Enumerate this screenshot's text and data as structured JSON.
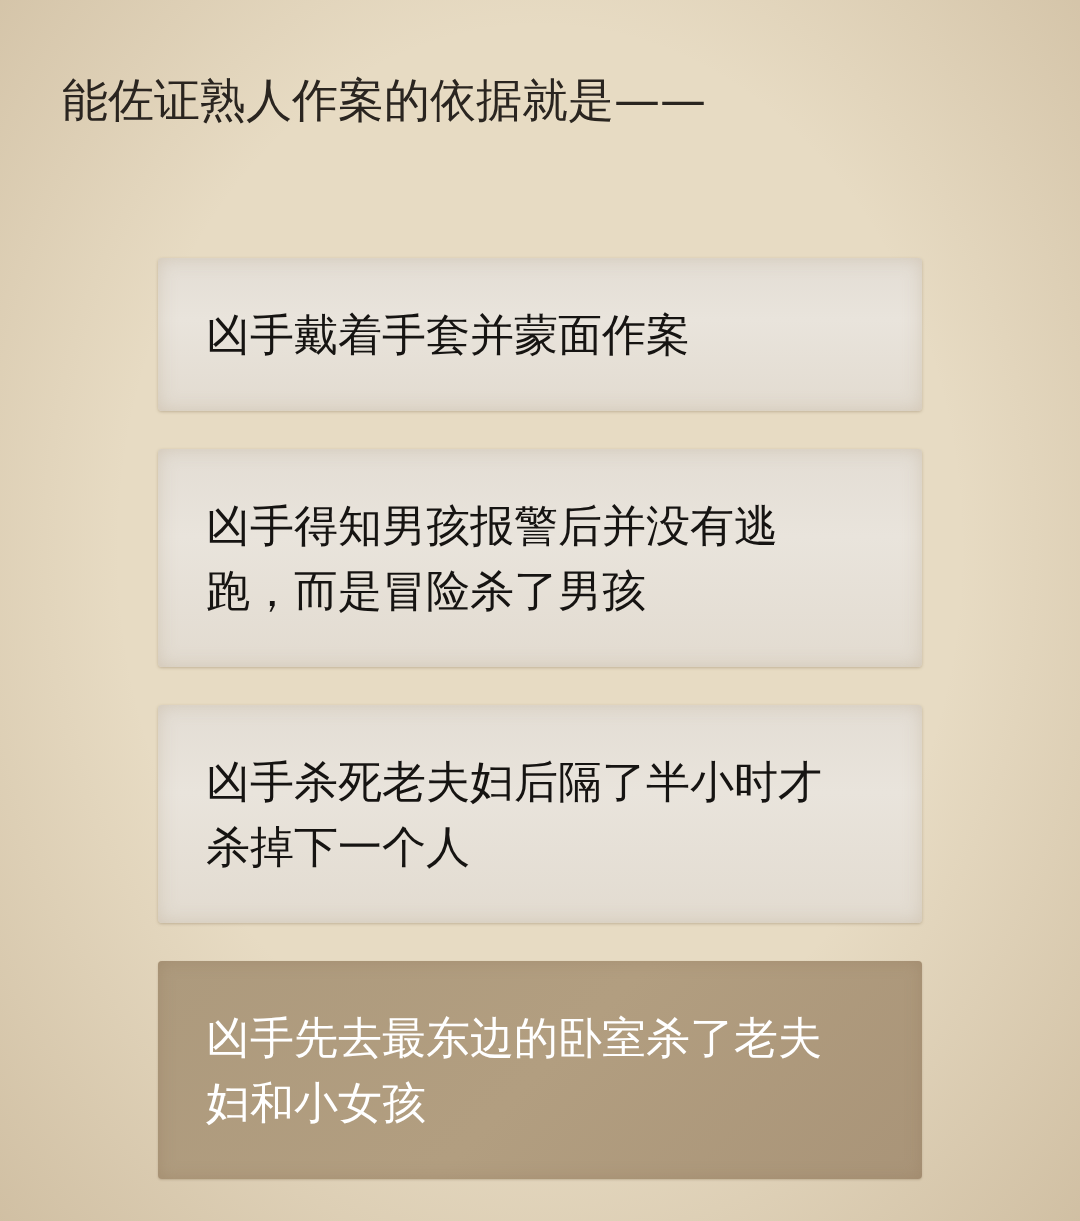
{
  "question": "能佐证熟人作案的依据就是——",
  "options": [
    {
      "text": "凶手戴着手套并蒙面作案",
      "selected": false
    },
    {
      "text": "凶手得知男孩报警后并没有逃跑，而是冒险杀了男孩",
      "selected": false
    },
    {
      "text": "凶手杀死老夫妇后隔了半小时才杀掉下一个人",
      "selected": false
    },
    {
      "text": "凶手先去最东边的卧室杀了老夫妇和小女孩",
      "selected": true
    }
  ]
}
